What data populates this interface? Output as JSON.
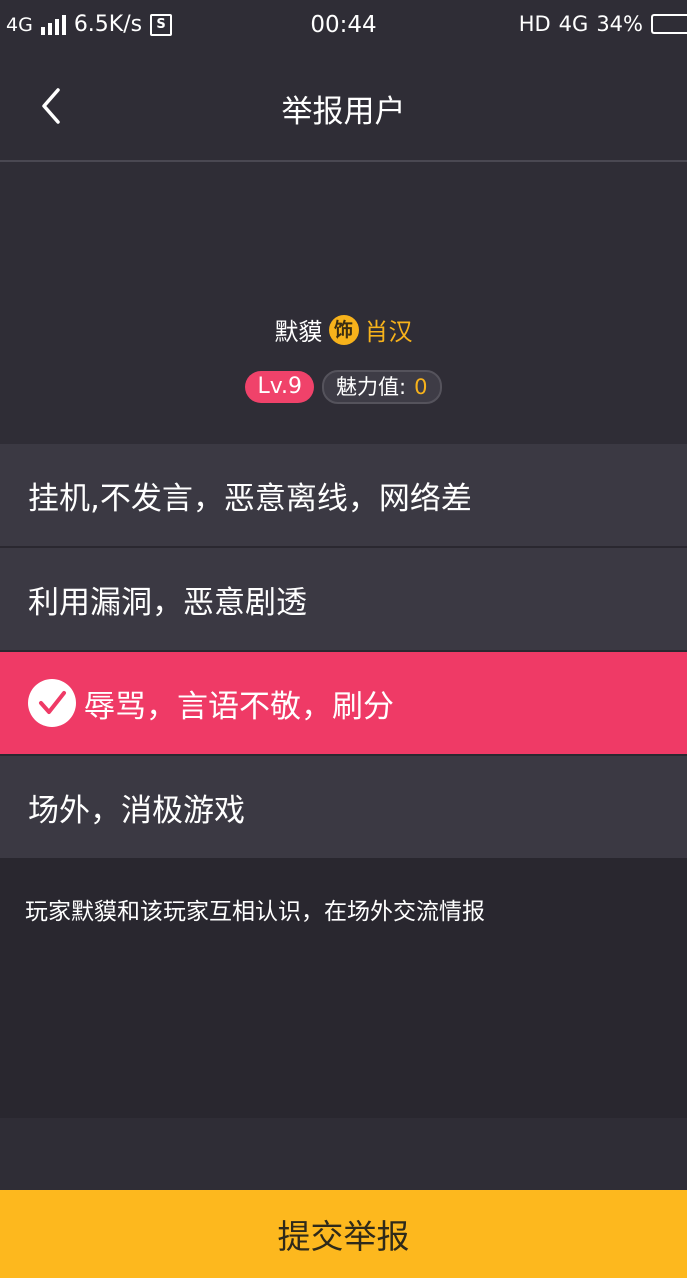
{
  "status_bar": {
    "network_left": "4G",
    "speed": "6.5K/s",
    "notification_icon": "S",
    "time": "00:44",
    "hd": "HD",
    "network_right": "4G",
    "battery": "34%"
  },
  "header": {
    "back_icon": "chevron-left-icon",
    "title": "举报用户"
  },
  "profile": {
    "name": "默貘",
    "role_badge": "饰",
    "role_name": "肖汉",
    "level": "Lv.9",
    "charm_label": "魅力值:",
    "charm_value": "0"
  },
  "options": [
    {
      "label": "挂机,不发言，恶意离线，网络差",
      "selected": false
    },
    {
      "label": "利用漏洞，恶意剧透",
      "selected": false
    },
    {
      "label": "辱骂，言语不敬，刷分",
      "selected": true
    },
    {
      "label": "场外，消极游戏",
      "selected": false
    }
  ],
  "detail": {
    "text": "玩家默貘和该玩家互相认识，在场外交流情报"
  },
  "submit": {
    "label": "提交举报"
  },
  "colors": {
    "background": "#2f2d36",
    "option_bg": "#3b3943",
    "selected": "#ef3a66",
    "accent": "#fdb81e",
    "level_badge": "#f0426a"
  }
}
